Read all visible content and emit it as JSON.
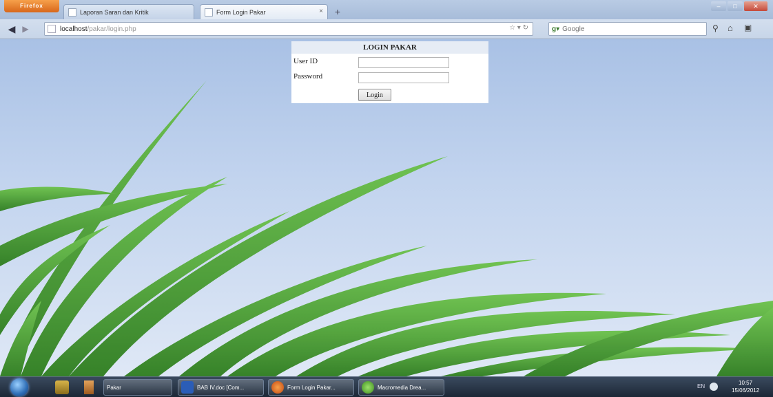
{
  "browser": {
    "menu_button_label": "Firefox",
    "tabs": [
      {
        "title": "Laporan Saran dan Kritik",
        "active": false
      },
      {
        "title": "Form Login Pakar",
        "active": true
      }
    ],
    "new_tab_label": "+",
    "url_host": "localhost",
    "url_path": "/pakar/login.php",
    "search_engine": "Google",
    "search_placeholder": "Google"
  },
  "login": {
    "title": "LOGIN PAKAR",
    "userid_label": "User ID",
    "password_label": "Password",
    "userid_value": "",
    "password_value": "",
    "button_label": "Login"
  },
  "taskbar": {
    "tasks": [
      {
        "label": "Pakar",
        "icon": "folder-icon",
        "color": "#c58a2e"
      },
      {
        "label": "BAB IV.doc [Com...",
        "icon": "word-icon",
        "color": "#2b5db7"
      },
      {
        "label": "Form Login Pakar...",
        "icon": "firefox-icon",
        "color": "#e0731f"
      },
      {
        "label": "Macromedia Drea...",
        "icon": "dreamweaver-icon",
        "color": "#5cae2f"
      }
    ],
    "lang": "EN",
    "time": "10:57",
    "date": "15/06/2012"
  },
  "colors": {
    "sky_top": "#a9c1e5",
    "sky_bottom": "#dfe8f6",
    "grass": "#3f9a2c"
  }
}
